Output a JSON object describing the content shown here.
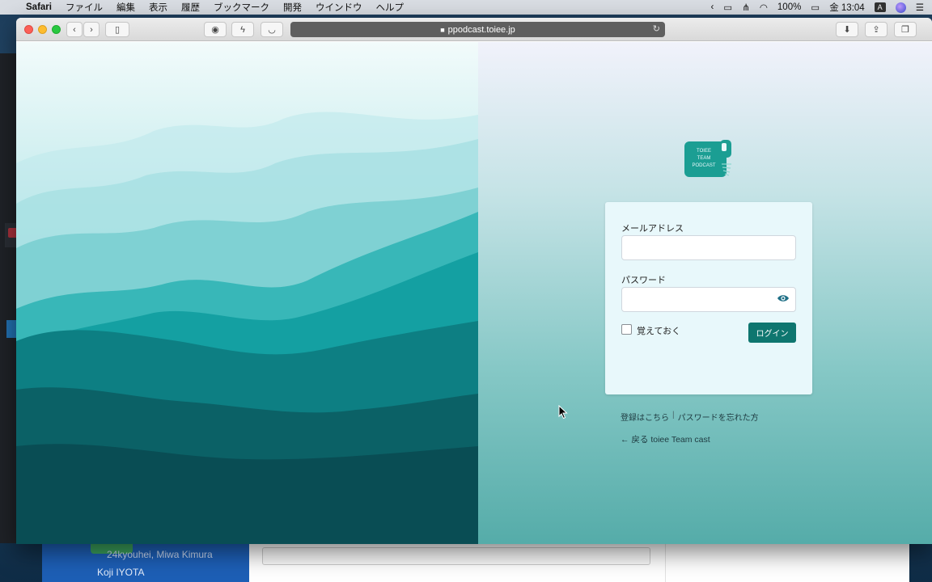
{
  "menubar": {
    "app": "Safari",
    "items": [
      "ファイル",
      "編集",
      "表示",
      "履歴",
      "ブックマーク",
      "開発",
      "ウインドウ",
      "ヘルプ"
    ],
    "battery": "100%",
    "clock": "金 13:04",
    "input_badge": "A"
  },
  "browser": {
    "url": "ppodcast.toiee.jp"
  },
  "logo": {
    "line1": "TOIEE",
    "line2": "TEAM",
    "line3": "PODCAST"
  },
  "form": {
    "email_label": "メールアドレス",
    "email_value": "",
    "password_label": "パスワード",
    "password_value": "",
    "remember_label": "覚えておく",
    "remember_checked": false,
    "login_label": "ログイン"
  },
  "links": {
    "register": "登録はこちら",
    "separator": "|",
    "lost_password": "パスワードを忘れた方",
    "back": "← 戻る toiee Team cast"
  },
  "background_app": {
    "line1": "24kyouhei, Miwa Kimura",
    "line2": "Koji IYOTA"
  },
  "colors": {
    "primary_button": "#0e766f",
    "logo": "#1b9e93",
    "eye_icon": "#1f6f86"
  }
}
